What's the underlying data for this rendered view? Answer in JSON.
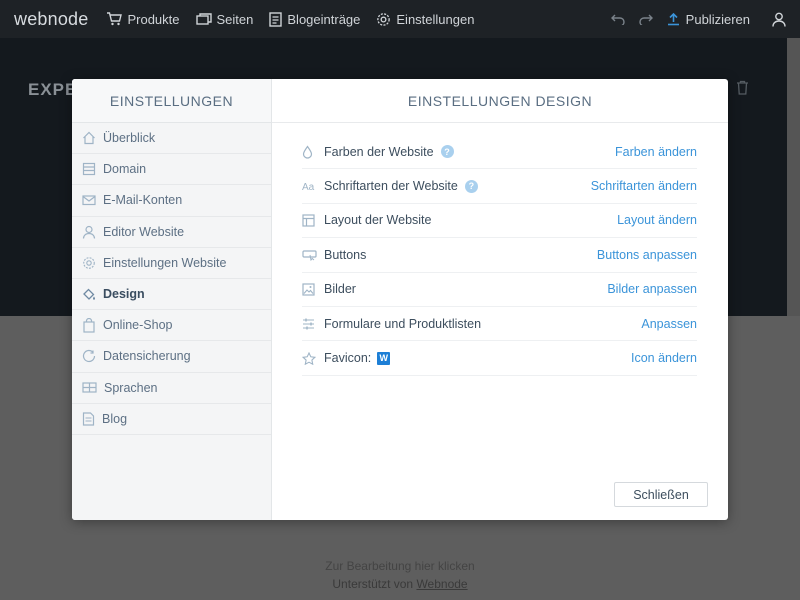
{
  "topbar": {
    "logo": "webnode",
    "nav": [
      {
        "label": "Produkte",
        "icon": "cart-icon"
      },
      {
        "label": "Seiten",
        "icon": "pages-icon"
      },
      {
        "label": "Blogeinträge",
        "icon": "blog-icon"
      },
      {
        "label": "Einstellungen",
        "icon": "gear-icon"
      }
    ],
    "publish_label": "Publizieren"
  },
  "background": {
    "hero_text": "EXPE",
    "footer_line1": "Zur Bearbeitung hier klicken",
    "footer_prefix": "Unterstützt von ",
    "footer_link": "Webnode"
  },
  "modal": {
    "sidebar_title": "EINSTELLUNGEN",
    "main_title": "EINSTELLUNGEN DESIGN",
    "sidebar_items": [
      {
        "label": "Überblick",
        "icon": "home-icon"
      },
      {
        "label": "Domain",
        "icon": "domain-icon"
      },
      {
        "label": "E-Mail-Konten",
        "icon": "mail-icon"
      },
      {
        "label": "Editor Website",
        "icon": "user-icon"
      },
      {
        "label": "Einstellungen Website",
        "icon": "gear-icon"
      },
      {
        "label": "Design",
        "icon": "paint-bucket-icon",
        "active": true
      },
      {
        "label": "Online-Shop",
        "icon": "shopping-bag-icon"
      },
      {
        "label": "Datensicherung",
        "icon": "backup-icon"
      },
      {
        "label": "Sprachen",
        "icon": "flag-icon"
      },
      {
        "label": "Blog",
        "icon": "blog-icon"
      }
    ],
    "rows": [
      {
        "label": "Farben der Website",
        "link": "Farben ändern",
        "icon": "drop-icon",
        "help": "?"
      },
      {
        "label": "Schriftarten der Website",
        "link": "Schriftarten ändern",
        "icon": "font-icon",
        "help": "?"
      },
      {
        "label": "Layout der Website",
        "link": "Layout ändern",
        "icon": "layout-icon"
      },
      {
        "label": "Buttons",
        "link": "Buttons anpassen",
        "icon": "button-icon"
      },
      {
        "label": "Bilder",
        "link": "Bilder anpassen",
        "icon": "image-icon"
      },
      {
        "label": "Formulare und Produktlisten",
        "link": "Anpassen",
        "icon": "sliders-icon"
      },
      {
        "label": "Favicon:",
        "link": "Icon ändern",
        "icon": "star-icon",
        "badge": "W"
      }
    ],
    "close_label": "Schließen"
  },
  "colors": {
    "topbar": "#1e2226",
    "link": "#3b94d9",
    "sidebar_text": "#5d7084",
    "help_badge": "#a9d0ee",
    "favicon_badge": "#1d7fd6"
  }
}
